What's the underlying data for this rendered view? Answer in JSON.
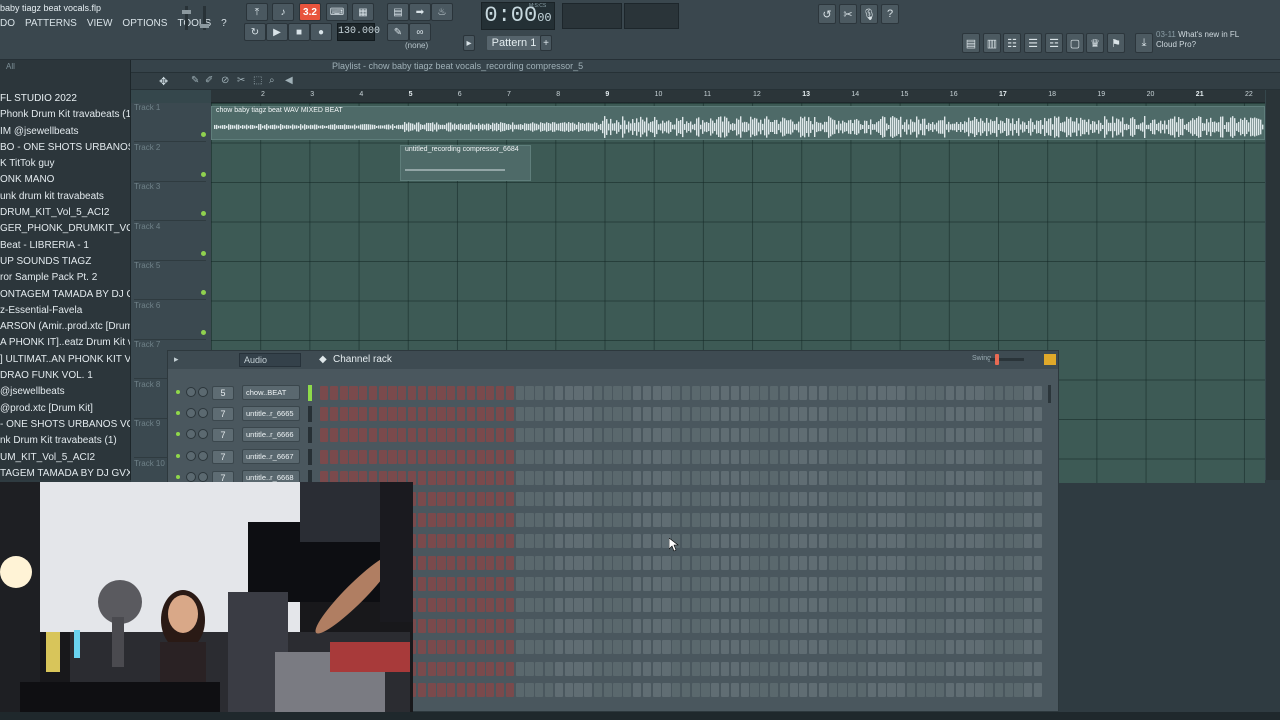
{
  "window": {
    "title": "baby tiagz beat vocals.flp"
  },
  "menu": [
    "DO",
    "PATTERNS",
    "VIEW",
    "OPTIONS",
    "TOOLS",
    "?"
  ],
  "transport": {
    "pat_song": "3.2",
    "tempo": "130.000",
    "time": "0:00",
    "time_small": "00",
    "time_unit": "M:S:CS",
    "pattern": "Pattern 1",
    "pattern_none": "(none)"
  },
  "news": {
    "date": "03-11",
    "line1": "What's new in FL",
    "line2": "Cloud Pro?"
  },
  "browser": {
    "filter": "All",
    "items": [
      "FL STUDIO 2022",
      "Phonk Drum Kit travabeats (1)",
      "IM @jsewellbeats",
      "BO - ONE SHOTS URBANOS VOL. 2",
      "K TitTok guy",
      "ONK MANO",
      "unk drum kit travabeats",
      "DRUM_KIT_Vol_5_ACI2",
      "GER_PHONK_DRUMKIT_VOL_3",
      "Beat - LIBRERIA - 1",
      "UP SOUNDS TIAGZ",
      "ror Sample Pack Pt. 2",
      "ONTAGEM TAMADA BY DJ GVX",
      "z-Essential-Favela",
      "ARSON (Amir..prod.xtc [Drum Kit]",
      "A PHONK IT]..eatz Drum Kit vol 1",
      "] ULTIMAT..AN PHONK KIT VOL. 3",
      "DRAO FUNK VOL. 1",
      "@jsewellbeats",
      "@prod.xtc [Drum Kit]",
      "- ONE SHOTS URBANOS VOL. 2",
      "nk Drum Kit travabeats (1)",
      "UM_KIT_Vol_5_ACI2",
      "TAGEM TAMADA BY DJ GVX"
    ]
  },
  "playlist": {
    "title": "Playlist - chow baby tiagz beat vocals_recording compressor_5",
    "ruler": [
      "2",
      "3",
      "4",
      "5",
      "6",
      "7",
      "8",
      "9",
      "10",
      "11",
      "12",
      "13",
      "14",
      "15",
      "16",
      "17",
      "18",
      "19",
      "20",
      "21",
      "22"
    ],
    "tracks": [
      "Track 1",
      "Track 2",
      "Track 3",
      "Track 4",
      "Track 5",
      "Track 6",
      "Track 7",
      "Track 8",
      "Track 9",
      "Track 10"
    ],
    "clips": [
      {
        "name": "chow baby tiagz beat WAV MIXED BEAT"
      },
      {
        "name": "untitled_recording compressor_6684"
      }
    ]
  },
  "channel_rack": {
    "filter": "Audio",
    "title": "Channel rack",
    "swing_label": "Swing",
    "channels": [
      {
        "num": "5",
        "name": "chow..BEAT"
      },
      {
        "num": "7",
        "name": "untitle..r_6665"
      },
      {
        "num": "7",
        "name": "untitle..r_6666"
      },
      {
        "num": "7",
        "name": "untitle..r_6667"
      },
      {
        "num": "7",
        "name": "untitle..r_6668"
      }
    ],
    "steps_per_row": 74
  },
  "colors": {
    "accent": "#e8543d",
    "grid": "#3d5a55",
    "step_red": "#7a4a4c",
    "led": "#90d84a"
  }
}
